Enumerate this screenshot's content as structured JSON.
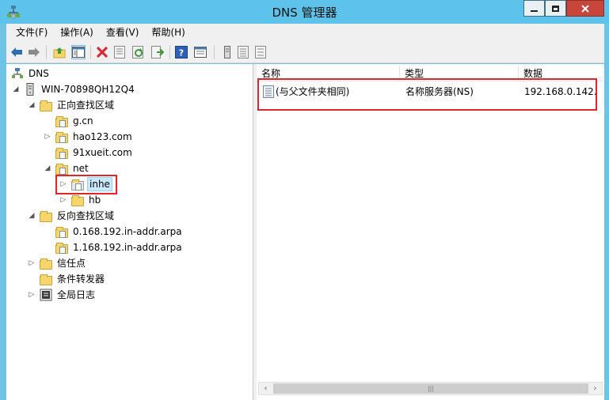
{
  "window": {
    "title": "DNS 管理器",
    "icon": "dns-manager-icon",
    "controls": {
      "minimize": "—",
      "maximize": "☐",
      "close": "✕"
    }
  },
  "menu": [
    {
      "label": "文件(F)"
    },
    {
      "label": "操作(A)"
    },
    {
      "label": "查看(V)"
    },
    {
      "label": "帮助(H)"
    }
  ],
  "toolbar": {
    "icons": [
      "back-arrow-icon",
      "forward-arrow-icon",
      "up-folder-icon",
      "show-hide-tree-icon",
      "delete-icon",
      "properties-icon",
      "refresh-icon",
      "export-list-icon",
      "help-icon",
      "console-icon",
      "server-icon",
      "list-icon"
    ]
  },
  "tree": {
    "root": "DNS",
    "server": "WIN-70898QH12Q4",
    "forward_zones": "正向查找区域",
    "zone_gcn": "g.cn",
    "zone_hao123": "hao123.com",
    "zone_91xueit": "91xueit.com",
    "zone_net": "net",
    "sub_inhe": "inhe",
    "sub_hb": "hb",
    "reverse_zones": "反向查找区域",
    "rev_0": "0.168.192.in-addr.arpa",
    "rev_1": "1.168.192.in-addr.arpa",
    "trust_points": "信任点",
    "forwarders": "条件转发器",
    "global_logs": "全局日志"
  },
  "list": {
    "columns": {
      "name": "名称",
      "type": "类型",
      "data": "数据"
    },
    "rows": [
      {
        "name": "(与父文件夹相同)",
        "type": "名称服务器(NS)",
        "data": "192.168.0.142."
      }
    ]
  },
  "colors": {
    "titlebar": "#5ec3ea",
    "highlight": "#e0262b",
    "selection": "#cce8ff"
  }
}
